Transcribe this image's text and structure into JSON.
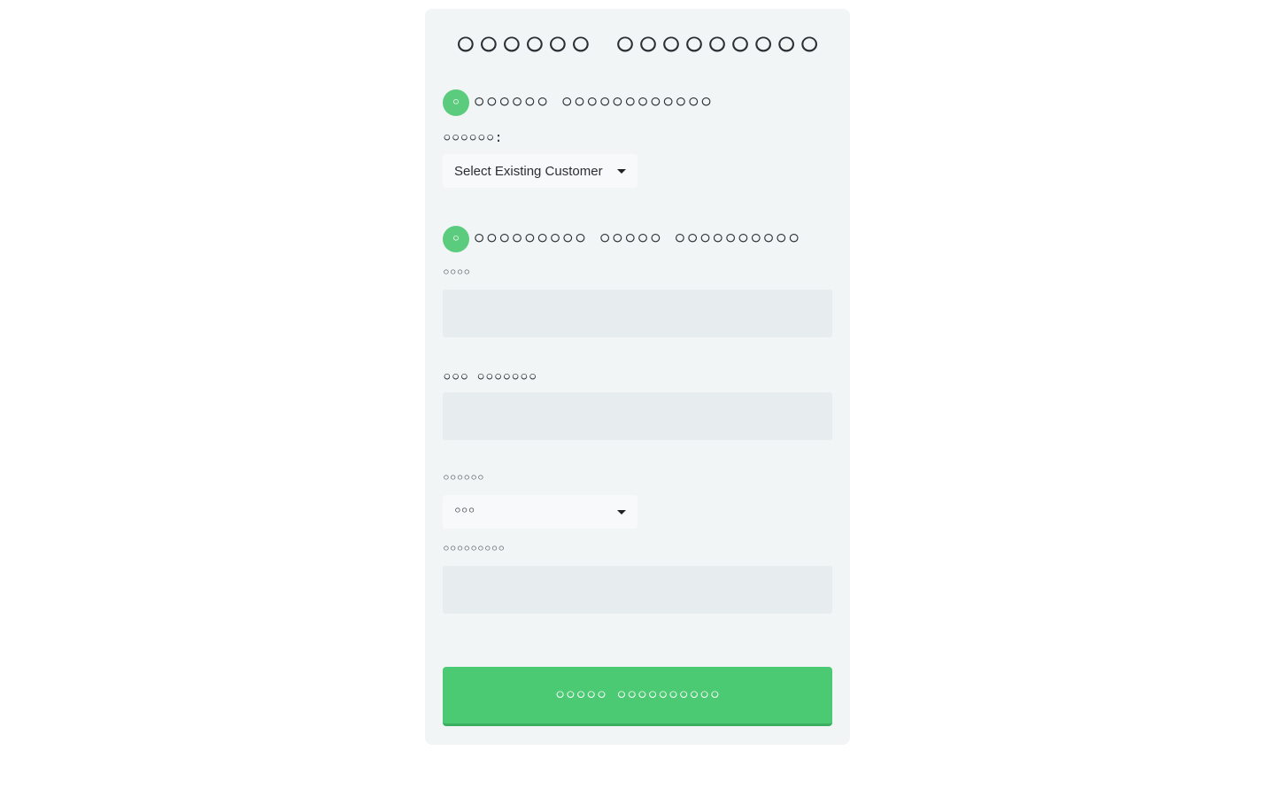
{
  "form": {
    "title": "০০০০০০ ০০০০০০০০০",
    "section1": {
      "badge": "০",
      "title": "০০০০০০ ০০০০০০০০০০০০",
      "customer_label": "০০০০০০:",
      "customer_dropdown": "Select Existing Customer"
    },
    "section2": {
      "badge": "০",
      "title": "০০০০০০০০০ ০০০০০ ০০০০০০০০০০",
      "name_label": "০০০০",
      "name_value": "",
      "phone_label": "০০০ ০০০০০০০",
      "phone_value": "",
      "type_label": "০০০০০০",
      "type_dropdown": "০০০",
      "address_label": "০০০০০০০০০",
      "address_value": ""
    },
    "submit_label": "০০০০০ ০০০০০০০০০০"
  }
}
